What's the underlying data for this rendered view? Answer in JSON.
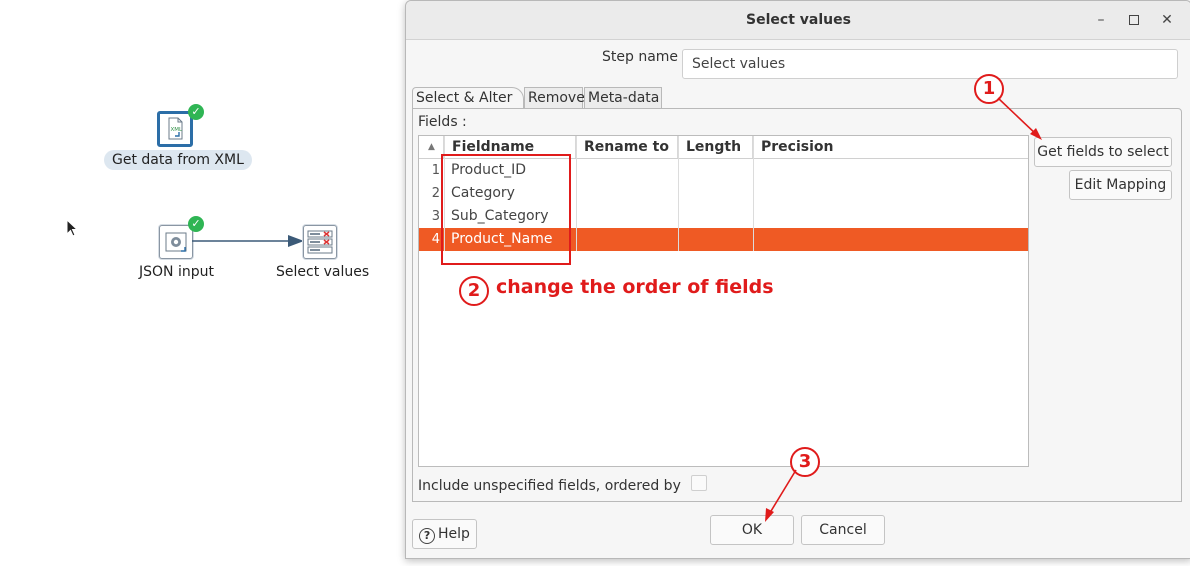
{
  "canvas": {
    "steps": [
      {
        "label": "Get data from XML",
        "icon": "xml-file-icon",
        "status": "ok"
      },
      {
        "label": "JSON input",
        "icon": "json-input-icon",
        "status": "ok"
      },
      {
        "label": "Select values",
        "icon": "select-values-icon",
        "status": ""
      }
    ]
  },
  "dialog": {
    "title": "Select values",
    "step_name_label": "Step name",
    "step_name_value": "Select values",
    "tabs": [
      "Select & Alter",
      "Remove",
      "Meta-data"
    ],
    "fields_label": "Fields :",
    "columns": [
      "Fieldname",
      "Rename to",
      "Length",
      "Precision"
    ],
    "rows": [
      {
        "num": "1",
        "fieldname": "Product_ID",
        "rename": "",
        "length": "",
        "precision": ""
      },
      {
        "num": "2",
        "fieldname": "Category",
        "rename": "",
        "length": "",
        "precision": ""
      },
      {
        "num": "3",
        "fieldname": "Sub_Category",
        "rename": "",
        "length": "",
        "precision": ""
      },
      {
        "num": "4",
        "fieldname": "Product_Name",
        "rename": "",
        "length": "",
        "precision": ""
      }
    ],
    "get_fields_button": "Get fields to select",
    "edit_mapping_button": "Edit Mapping",
    "include_unspecified_label": "Include unspecified fields, ordered by na",
    "help_button": "Help",
    "ok_button": "OK",
    "cancel_button": "Cancel"
  },
  "annotations": {
    "marker1": "1",
    "marker2": "2",
    "marker3": "3",
    "note": "change the order of fields",
    "color": "#e01b1b"
  },
  "colors": {
    "selected_row": "#ef5a24",
    "accent": "#2c6ea7",
    "ok_badge": "#2fb554"
  }
}
